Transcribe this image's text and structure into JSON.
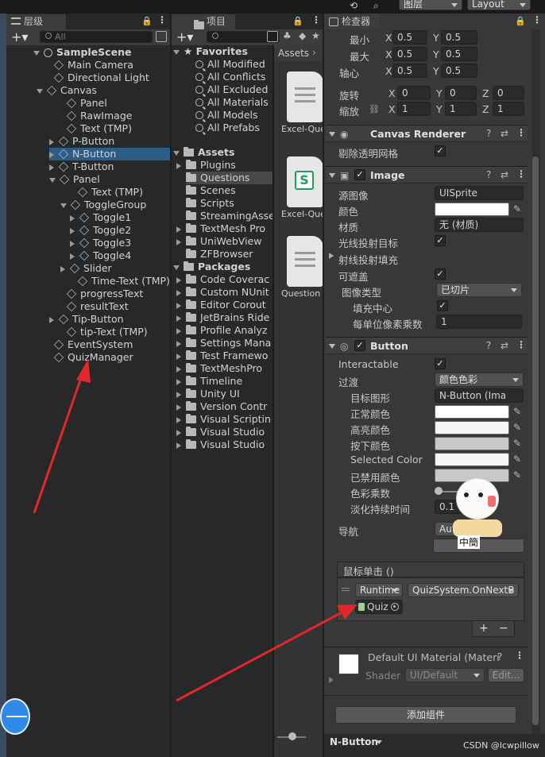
{
  "hierarchy": {
    "title": "层级",
    "search_placeholder": "All",
    "scene": "SampleScene",
    "items": [
      "Main Camera",
      "Directional Light",
      "Canvas",
      "Panel",
      "RawImage",
      "Text (TMP)",
      "P-Button",
      "N-Button",
      "T-Button",
      "Panel",
      "Text (TMP)",
      "ToggleGroup",
      "Toggle1",
      "Toggle2",
      "Toggle3",
      "Toggle4",
      "Slider",
      "Time-Text (TMP)",
      "progressText",
      "resultText",
      "Tip-Button",
      "tip-Text (TMP)",
      "EventSystem",
      "QuizManager"
    ]
  },
  "project": {
    "title": "项目",
    "breadcrumb": "Assets",
    "favorites_header": "Favorites",
    "favorites": [
      "All Modified",
      "All Conflicts",
      "All Excluded",
      "All Materials",
      "All Models",
      "All Prefabs"
    ],
    "assets_header": "Assets",
    "assets": [
      "Plugins",
      "Questions",
      "Scenes",
      "Scripts",
      "StreamingAsse",
      "TextMesh Pro",
      "UniWebView",
      "ZFBrowser"
    ],
    "packages_header": "Packages",
    "packages": [
      "Code Coverac",
      "Custom NUnit",
      "Editor Corout",
      "JetBrains Ride",
      "Profile Analyz",
      "Settings Mana",
      "Test Framewo",
      "TextMeshPro",
      "Timeline",
      "Unity UI",
      "Version Contr",
      "Visual Scriptin",
      "Visual Studio",
      "Visual Studio"
    ],
    "files": [
      "Excel-Que",
      "Excel-Que",
      "Question"
    ]
  },
  "topbar": {
    "layers": "图层",
    "layout": "Layout"
  },
  "inspector": {
    "title": "检查器",
    "rect": {
      "min_label": "最小",
      "max_label": "最大",
      "pivot_label": "轴心",
      "rotation_label": "旋转",
      "scale_label": "缩放",
      "x": "X",
      "y": "Y",
      "z": "Z",
      "min_x": "0.5",
      "min_y": "0.5",
      "max_x": "0.5",
      "max_y": "0.5",
      "pivot_x": "0.5",
      "pivot_y": "0.5",
      "rot_x": "0",
      "rot_y": "0",
      "rot_z": "0",
      "scale_x": "1",
      "scale_y": "1",
      "scale_z": "1"
    },
    "canvas_renderer": {
      "title": "Canvas Renderer",
      "cull_label": "剔除透明网格"
    },
    "image": {
      "title": "Image",
      "source_label": "源图像",
      "source_value": "UISprite",
      "color_label": "颜色",
      "material_label": "材质",
      "material_value": "无 (材质)",
      "raycast_target": "光线投射目标",
      "raycast_padding": "射线投射填充",
      "maskable": "可遮盖",
      "image_type_label": "图像类型",
      "image_type_value": "已切片",
      "fill_center": "填充中心",
      "ppu_label": "每单位像素乘数",
      "ppu_value": "1"
    },
    "button": {
      "title": "Button",
      "interactable": "Interactable",
      "transition_label": "过渡",
      "transition_value": "颜色色彩",
      "target_label": "目标图形",
      "target_value": "N-Button (Ima",
      "normal": "正常颜色",
      "highlighted": "高亮颜色",
      "pressed": "按下颜色",
      "selected": "Selected Color",
      "disabled": "已禁用颜色",
      "multiplier": "色彩乘数",
      "fade_label": "淡化持续时间",
      "fade_value": "0.1",
      "nav_label": "导航",
      "nav_value": "Auto",
      "onclick": "鼠标单击 ()",
      "runtime": "Runtime",
      "function": "QuizSystem.OnNextB",
      "object": "Quiz",
      "plus": "+",
      "minus": "−"
    },
    "material": {
      "title": "Default UI Material (Materi",
      "shader_label": "Shader",
      "shader_value": "UI/Default",
      "edit": "Edit..."
    },
    "add_component": "添加组件",
    "footer_object": "N-Button",
    "watermark": "CSDN @lcwpillow",
    "sticker_text": "中簡"
  },
  "colors": {
    "selection": "#2c5d87",
    "annotation": "#e0282a"
  }
}
